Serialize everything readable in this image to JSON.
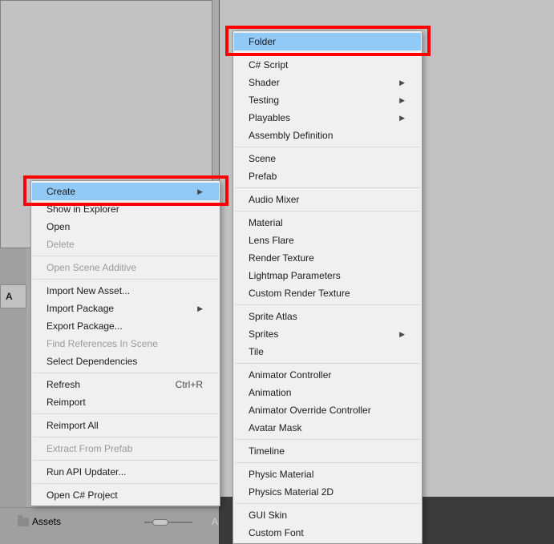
{
  "background": {
    "assets_label_top": "A",
    "assets_label_bottom": "Assets",
    "partial_a": "A"
  },
  "menu_left": [
    {
      "label": "Create",
      "submenu": true,
      "highlight": true
    },
    {
      "label": "Show in Explorer"
    },
    {
      "label": "Open"
    },
    {
      "label": "Delete",
      "disabled": true
    },
    {
      "sep": true
    },
    {
      "label": "Open Scene Additive",
      "disabled": true
    },
    {
      "sep": true
    },
    {
      "label": "Import New Asset..."
    },
    {
      "label": "Import Package",
      "submenu": true
    },
    {
      "label": "Export Package..."
    },
    {
      "label": "Find References In Scene",
      "disabled": true
    },
    {
      "label": "Select Dependencies"
    },
    {
      "sep": true
    },
    {
      "label": "Refresh",
      "shortcut": "Ctrl+R"
    },
    {
      "label": "Reimport"
    },
    {
      "sep": true
    },
    {
      "label": "Reimport All"
    },
    {
      "sep": true
    },
    {
      "label": "Extract From Prefab",
      "disabled": true
    },
    {
      "sep": true
    },
    {
      "label": "Run API Updater..."
    },
    {
      "sep": true
    },
    {
      "label": "Open C# Project"
    }
  ],
  "menu_right": [
    {
      "label": "Folder",
      "highlight": true
    },
    {
      "sep": true
    },
    {
      "label": "C# Script"
    },
    {
      "label": "Shader",
      "submenu": true
    },
    {
      "label": "Testing",
      "submenu": true
    },
    {
      "label": "Playables",
      "submenu": true
    },
    {
      "label": "Assembly Definition"
    },
    {
      "sep": true
    },
    {
      "label": "Scene"
    },
    {
      "label": "Prefab"
    },
    {
      "sep": true
    },
    {
      "label": "Audio Mixer"
    },
    {
      "sep": true
    },
    {
      "label": "Material"
    },
    {
      "label": "Lens Flare"
    },
    {
      "label": "Render Texture"
    },
    {
      "label": "Lightmap Parameters"
    },
    {
      "label": "Custom Render Texture"
    },
    {
      "sep": true
    },
    {
      "label": "Sprite Atlas"
    },
    {
      "label": "Sprites",
      "submenu": true
    },
    {
      "label": "Tile"
    },
    {
      "sep": true
    },
    {
      "label": "Animator Controller"
    },
    {
      "label": "Animation"
    },
    {
      "label": "Animator Override Controller"
    },
    {
      "label": "Avatar Mask"
    },
    {
      "sep": true
    },
    {
      "label": "Timeline"
    },
    {
      "sep": true
    },
    {
      "label": "Physic Material"
    },
    {
      "label": "Physics Material 2D"
    },
    {
      "sep": true
    },
    {
      "label": "GUI Skin"
    },
    {
      "label": "Custom Font"
    }
  ]
}
